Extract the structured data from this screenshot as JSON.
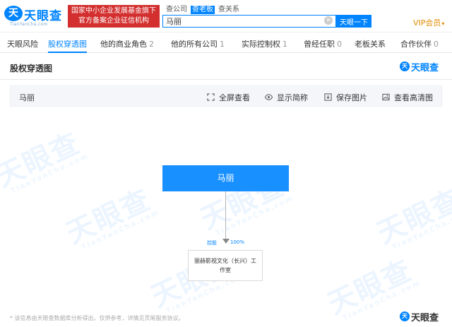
{
  "header": {
    "logo_mark": "天",
    "logo_text": "天眼查",
    "logo_sub": "TianYanCha.com",
    "banner_line1": "国家中小企业发展基金旗下",
    "banner_line2": "官方备案企业征信机构",
    "search_tabs": [
      "查公司",
      "查老板",
      "查关系"
    ],
    "search_value": "马丽",
    "search_clear": "×",
    "search_button": "天眼一下",
    "vip": "VIP会员",
    "vip_caret": "▾"
  },
  "nav": {
    "items": [
      {
        "label": "天眼风险",
        "count": ""
      },
      {
        "label": "股权穿透图",
        "count": ""
      },
      {
        "label": "他的商业角色",
        "count": "2"
      },
      {
        "label": "他的所有公司",
        "count": "1"
      },
      {
        "label": "实际控制权",
        "count": "1"
      },
      {
        "label": "曾经任职",
        "count": "0"
      },
      {
        "label": "老板关系",
        "count": ""
      },
      {
        "label": "合作伙伴",
        "count": "0"
      }
    ]
  },
  "section": {
    "title": "股权穿透图",
    "logo_text": "天眼查"
  },
  "toolbar": {
    "name": "马丽",
    "fullscreen": "全屏查看",
    "show_short": "显示简称",
    "save_image": "保存图片",
    "hd_image": "查看高清图"
  },
  "graph": {
    "root": "马丽",
    "edge_label": "控股",
    "edge_percent": "100%",
    "child": "丽赫影视文化（长兴）工作室"
  },
  "footer": {
    "note": "* 该信息由天眼查数据库分析得出，仅供参考，详情见页尾服务协议。",
    "logo_text": "天眼查"
  },
  "colors": {
    "brand": "#0084ff",
    "node": "#1890ff",
    "banner": "#d32f2f",
    "vip": "#e08b00"
  },
  "icons": [
    "fullscreen-icon",
    "eye-icon",
    "save-icon",
    "image-icon"
  ]
}
